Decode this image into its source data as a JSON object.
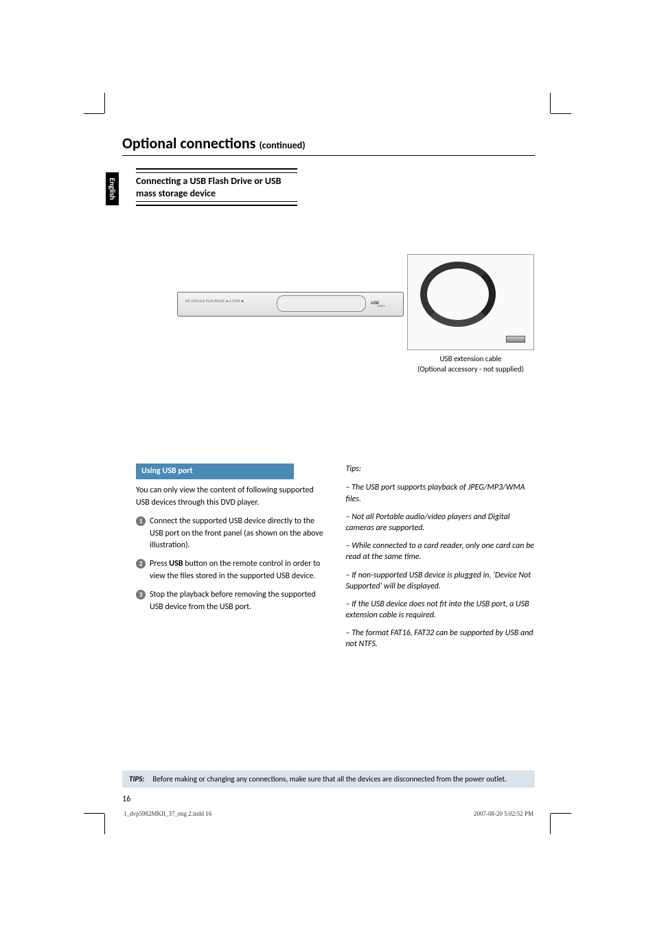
{
  "heading": {
    "title": "Optional connections ",
    "continued": "(continued)"
  },
  "langTab": "English",
  "sectionTitle": "Connecting a USB Flash Drive or USB mass storage device",
  "illustration": {
    "deviceLabels": "HD UPSCALE   PLAY/PAUSE ►II   STOP ■",
    "usbLabel": "USB",
    "usbSub": "DIRECT",
    "captionLine1": "USB extension cable",
    "captionLine2": "(Optional accessory - not supplied)"
  },
  "leftCol": {
    "subHeading": "Using USB port",
    "intro": "You can only view the content of following supported USB devices through this DVD player.",
    "items": [
      {
        "num": "1",
        "text": "Connect the supported USB device directly to the USB port on the front panel (as shown on the above illustration)."
      },
      {
        "num": "2",
        "pre": "Press ",
        "bold": "USB",
        "post": " button on the remote control in order to view the files stored in the supported USB device."
      },
      {
        "num": "3",
        "text": "Stop the playback before removing the supported USB device from the USB port."
      }
    ]
  },
  "rightCol": {
    "tipsHead": "Tips:",
    "tips": [
      "–  The USB port supports playback of JPEG/MP3/WMA files.",
      "–  Not all Portable audio/video players and Digital cameras are supported.",
      "–  While connected to a card reader, only one card can be read at the same time.",
      "–  If non-supported USB device is plugged in, 'Device Not Supported' will be displayed.",
      "–  If the USB device does not fit into the USB port, a USB extension cable is required.",
      "–  The format FAT16, FAT32 can be supported by USB and not NTFS."
    ]
  },
  "tipsBox": {
    "label": "TIPS:",
    "text": "Before making or changing any connections, make sure that all the devices are disconnected from the power outlet."
  },
  "pageNum": "16",
  "footer": {
    "left": "1_dvp5982MKII_37_eng 2.indd   16",
    "right": "2007-08-20   5:02:52 PM"
  }
}
